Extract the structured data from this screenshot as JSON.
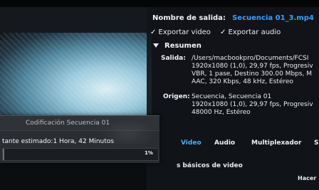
{
  "output": {
    "name_label": "Nombre de salida:",
    "name_value": "Secuencia 01_3.mp4",
    "export_video": "Exportar video",
    "export_audio": "Exportar audio"
  },
  "summary": {
    "header": "Resumen",
    "salida_label": "Salida:",
    "salida_lines": [
      "/Users/macbookpro/Documents/FCSI",
      "1920x1080 (1,0), 29,97 fps, Progresiv",
      "VBR, 1 pase, Destino 300.00 Mbps, M",
      "AAC, 320 Kbps, 48 kHz, Estéreo"
    ],
    "origen_label": "Origen:",
    "origen_lines": [
      "Secuencia, Secuencia 01",
      "1920x1080 (1,0), 29,97 fps, Progresiv",
      "48000 Hz, Estéreo"
    ]
  },
  "tabs": [
    {
      "label": "Video",
      "active": true
    },
    {
      "label": "Audio",
      "active": false
    },
    {
      "label": "Multiplexador",
      "active": false
    },
    {
      "label": "S",
      "active": false
    }
  ],
  "section": {
    "basic_settings": "s básicos de video",
    "hacer": "Hacer"
  },
  "encoding_dialog": {
    "title": "Codificación Secuencia 01",
    "remaining": "tante estimado:1 Hora, 42 Minutos",
    "progress_label": "1%",
    "progress_fraction": 0.01
  },
  "colors": {
    "accent_blue": "#3aa0ff",
    "active_tab": "#49b0ff"
  }
}
